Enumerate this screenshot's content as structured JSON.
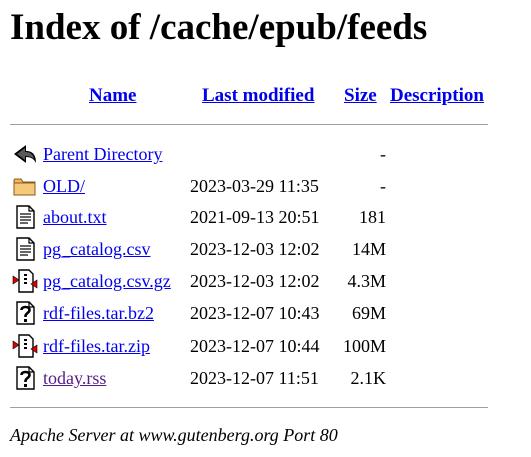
{
  "page_title": "Index of /cache/epub/feeds",
  "columns": {
    "name": "Name",
    "last_modified": "Last modified",
    "size": "Size",
    "description": "Description"
  },
  "rows": [
    {
      "icon": "back-arrow-icon",
      "name": "Parent Directory",
      "modified": "",
      "size": "-",
      "visited": false
    },
    {
      "icon": "folder-icon",
      "name": "OLD/",
      "modified": "2023-03-29 11:35",
      "size": "-",
      "visited": false
    },
    {
      "icon": "text-file-icon",
      "name": "about.txt",
      "modified": "2021-09-13 20:51",
      "size": "181",
      "visited": false
    },
    {
      "icon": "text-file-icon",
      "name": "pg_catalog.csv",
      "modified": "2023-12-03 12:02",
      "size": "14M",
      "visited": false
    },
    {
      "icon": "compressed-file-icon",
      "name": "pg_catalog.csv.gz",
      "modified": "2023-12-03 12:02",
      "size": "4.3M",
      "visited": false
    },
    {
      "icon": "unknown-file-icon",
      "name": "rdf-files.tar.bz2",
      "modified": "2023-12-07 10:43",
      "size": "69M",
      "visited": false
    },
    {
      "icon": "compressed-file-icon",
      "name": "rdf-files.tar.zip",
      "modified": "2023-12-07 10:44",
      "size": "100M",
      "visited": false
    },
    {
      "icon": "unknown-file-icon",
      "name": "today.rss",
      "modified": "2023-12-07 11:51",
      "size": "2.1K",
      "visited": true
    }
  ],
  "footer": "Apache Server at www.gutenberg.org Port 80",
  "colors": {
    "link": "#0000ee",
    "visited": "#551a8b",
    "rule": "#a0a0a0"
  }
}
